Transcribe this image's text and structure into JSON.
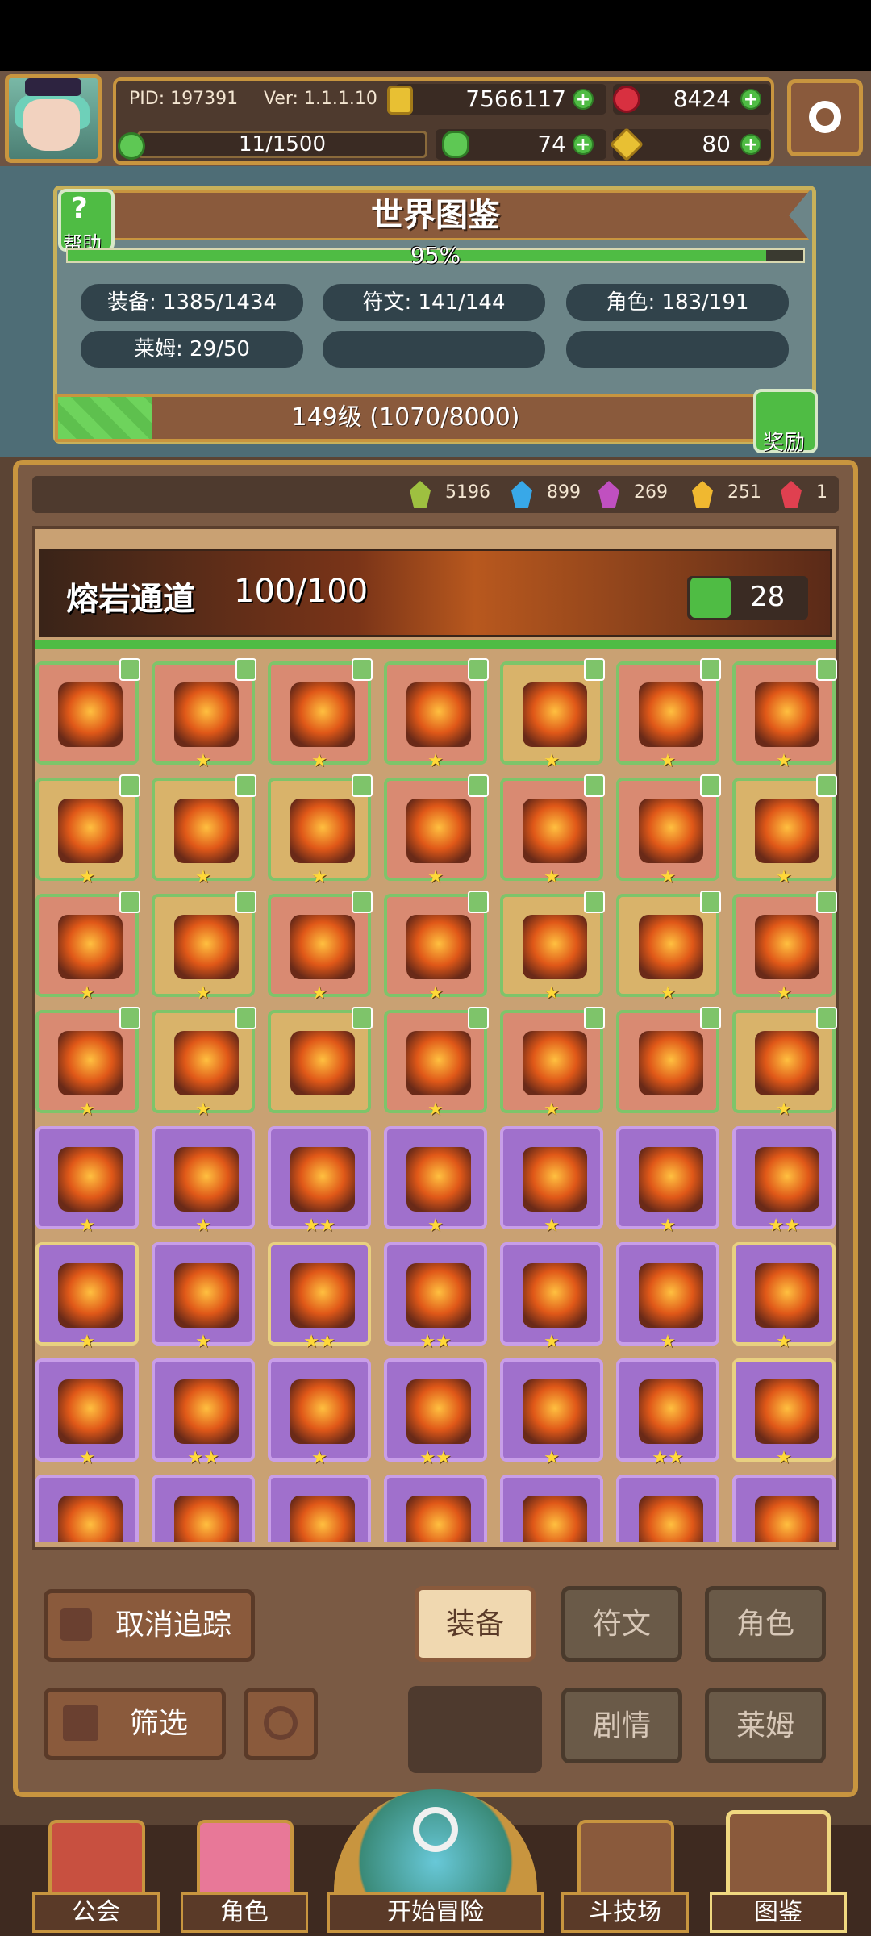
{
  "player": {
    "pid": "PID: 197391",
    "version": "Ver: 1.1.1.10",
    "gold": "7566117",
    "rubies": "8424",
    "stamina": "11/1500",
    "clovers": "74",
    "keys": "80"
  },
  "codex": {
    "help_label": "帮助",
    "help_icon": "?",
    "title": "世界图鉴",
    "progress_text": "95%",
    "progress_percent": 95,
    "stats": {
      "equipment": "装备: 1385/1434",
      "runes": "符文: 141/144",
      "characters": "角色: 183/191",
      "slimes": "莱姆: 29/50"
    },
    "level_text": "149级 (1070/8000)",
    "level_progress_fraction": 0.134,
    "reward_label": "奖励"
  },
  "gems": [
    {
      "count": "5196",
      "color": "#9ec040"
    },
    {
      "count": "899",
      "color": "#38a8e8"
    },
    {
      "count": "269",
      "color": "#c050c0"
    },
    {
      "count": "251",
      "color": "#f0b830"
    },
    {
      "count": "1",
      "color": "#e04050"
    }
  ],
  "stage": {
    "name": "熔岩通道",
    "count": "100/100",
    "likes": "28"
  },
  "items": [
    [
      "r",
      "",
      "thumb"
    ],
    [
      "r",
      "★",
      "thumb"
    ],
    [
      "r",
      "★",
      "thumb"
    ],
    [
      "r",
      "★",
      "thumb"
    ],
    [
      "y",
      "★",
      "thumb"
    ],
    [
      "r",
      "★",
      "thumb"
    ],
    [
      "r",
      "★",
      "thumb"
    ],
    [
      "y",
      "★",
      "thumb"
    ],
    [
      "y",
      "★",
      "thumb"
    ],
    [
      "y",
      "★",
      "thumb"
    ],
    [
      "r",
      "★",
      "thumb"
    ],
    [
      "r",
      "★",
      "thumb"
    ],
    [
      "r",
      "★",
      "thumb"
    ],
    [
      "y",
      "★",
      "thumb"
    ],
    [
      "r",
      "★",
      "thumb"
    ],
    [
      "y",
      "★",
      "thumb"
    ],
    [
      "r",
      "★",
      "thumb"
    ],
    [
      "r",
      "★",
      "thumb"
    ],
    [
      "y",
      "★",
      "thumb"
    ],
    [
      "y",
      "★",
      "thumb"
    ],
    [
      "r",
      "★",
      "thumb"
    ],
    [
      "r",
      "★",
      "thumb"
    ],
    [
      "y",
      "★",
      "thumb"
    ],
    [
      "y",
      "",
      "thumb"
    ],
    [
      "r",
      "★",
      "thumb"
    ],
    [
      "r",
      "★",
      "thumb"
    ],
    [
      "r",
      "",
      "thumb"
    ],
    [
      "y",
      "★",
      "thumb"
    ],
    [
      "pr",
      "★",
      ""
    ],
    [
      "pr",
      "★",
      ""
    ],
    [
      "pr",
      "★★",
      ""
    ],
    [
      "pr",
      "★",
      ""
    ],
    [
      "pr",
      "★",
      ""
    ],
    [
      "pr",
      "★",
      ""
    ],
    [
      "pr",
      "★★",
      ""
    ],
    [
      "py",
      "★",
      ""
    ],
    [
      "pr",
      "★",
      ""
    ],
    [
      "py",
      "★★",
      ""
    ],
    [
      "pr",
      "★★",
      ""
    ],
    [
      "pr",
      "★",
      ""
    ],
    [
      "pr",
      "★",
      ""
    ],
    [
      "py",
      "★",
      ""
    ],
    [
      "pr",
      "★",
      ""
    ],
    [
      "pr",
      "★★",
      ""
    ],
    [
      "pr",
      "★",
      ""
    ],
    [
      "pr",
      "★★",
      ""
    ],
    [
      "pr",
      "★",
      ""
    ],
    [
      "pr",
      "★★",
      ""
    ],
    [
      "py",
      "★",
      ""
    ],
    [
      "pr",
      "",
      ""
    ],
    [
      "pr",
      "",
      ""
    ],
    [
      "pr",
      "",
      ""
    ],
    [
      "pr",
      "",
      ""
    ],
    [
      "pr",
      "",
      ""
    ],
    [
      "pr",
      "",
      ""
    ],
    [
      "pr",
      "",
      ""
    ]
  ],
  "buttons": {
    "untrack": "取消追踪",
    "equipment": "装备",
    "runes": "符文",
    "characters": "角色",
    "filter": "筛选",
    "story": "剧情",
    "slime": "莱姆"
  },
  "nav": {
    "guild": "公会",
    "character": "角色",
    "adventure": "开始冒险",
    "arena": "斗技场",
    "codex": "图鉴"
  },
  "icons": {
    "gold": "gold-coin-icon",
    "ruby": "ruby-icon",
    "stamina": "stamina-icon",
    "clover": "clover-icon",
    "key": "key-icon",
    "settings": "gear-icon",
    "help": "help-icon",
    "reward": "reward-icon",
    "like": "thumbs-up-icon",
    "filter": "grid-icon",
    "refresh": "refresh-icon"
  }
}
